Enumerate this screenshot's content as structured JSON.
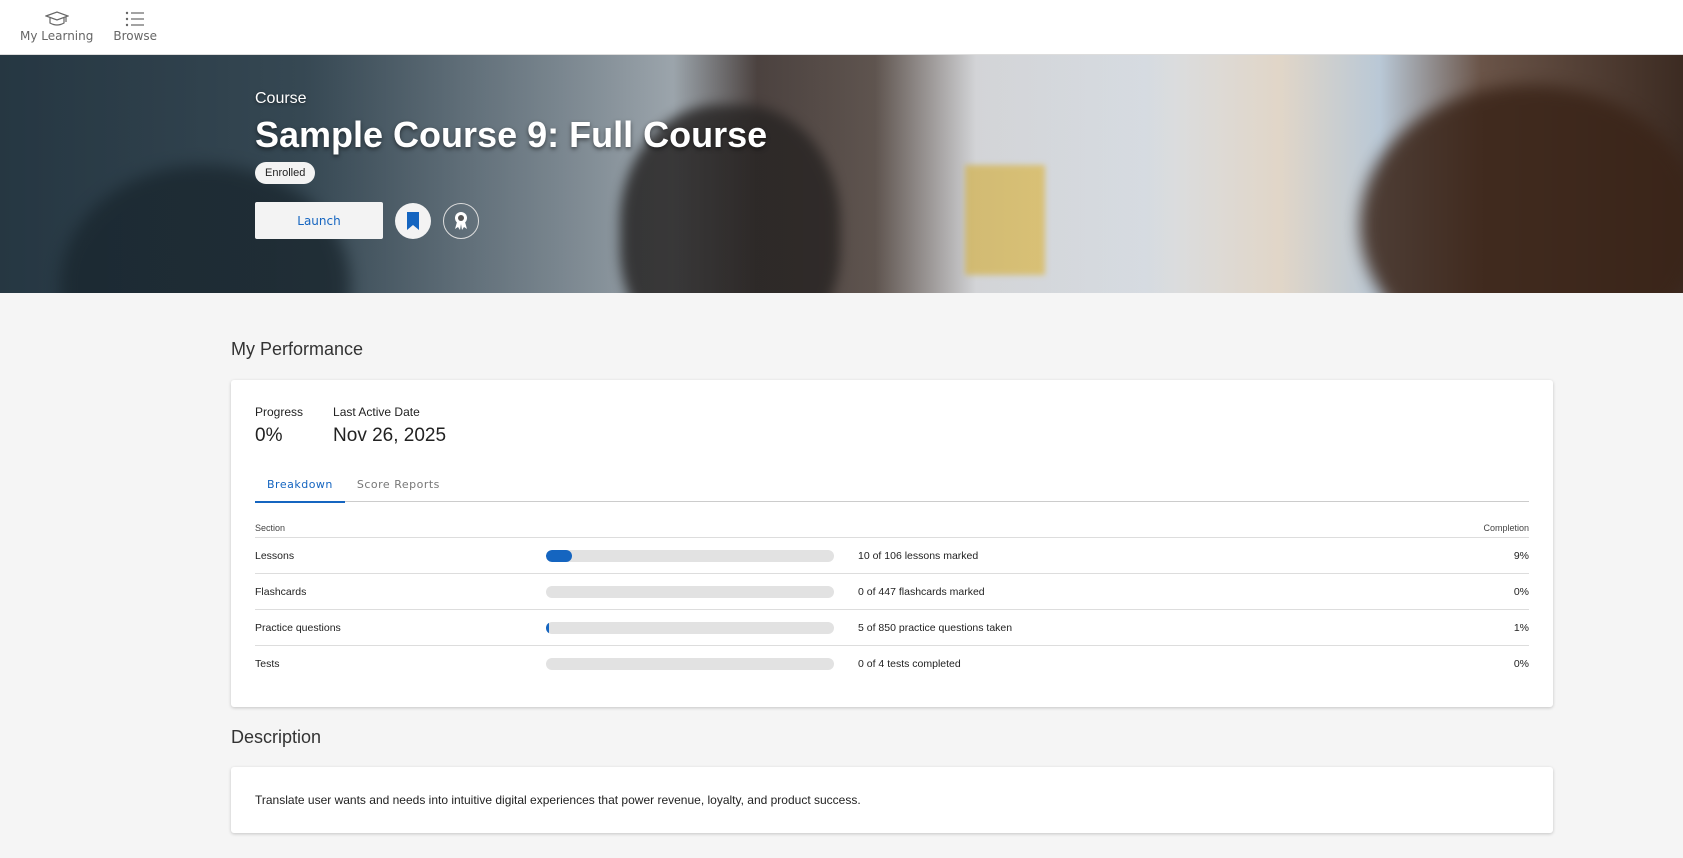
{
  "nav": {
    "items": [
      {
        "label": "My Learning",
        "icon": "graduation-cap-icon"
      },
      {
        "label": "Browse",
        "icon": "list-icon"
      }
    ]
  },
  "hero": {
    "type": "Course",
    "title": "Sample Course 9: Full Course",
    "status": "Enrolled",
    "launch_label": "Launch"
  },
  "performance": {
    "title": "My Performance",
    "progress_label": "Progress",
    "progress_value": "0%",
    "last_active_label": "Last Active Date",
    "last_active_value": "Nov 26, 2025",
    "tabs": [
      "Breakdown",
      "Score Reports"
    ],
    "columns": {
      "section": "Section",
      "completion": "Completion"
    },
    "rows": [
      {
        "name": "Lessons",
        "detail": "10 of 106 lessons marked",
        "pct": "9%",
        "fill": 9
      },
      {
        "name": "Flashcards",
        "detail": "0 of 447 flashcards marked",
        "pct": "0%",
        "fill": 0
      },
      {
        "name": "Practice questions",
        "detail": "5 of 850 practice questions taken",
        "pct": "1%",
        "fill": 1
      },
      {
        "name": "Tests",
        "detail": "0 of 4 tests completed",
        "pct": "0%",
        "fill": 0
      }
    ]
  },
  "description": {
    "title": "Description",
    "text": "Translate user wants and needs into intuitive digital experiences that power revenue, loyalty, and product success."
  },
  "colors": {
    "accent": "#1565c0"
  }
}
